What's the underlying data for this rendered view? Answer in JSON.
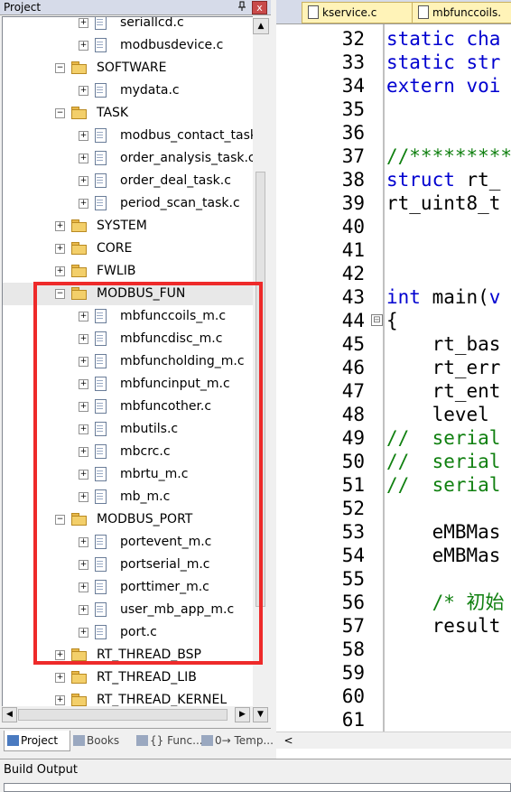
{
  "project_panel": {
    "title": "Project",
    "pin_icon": "pin-icon",
    "close_glyph": "x"
  },
  "tree": [
    {
      "type": "file",
      "indent": 2,
      "label": "seriallcd.c"
    },
    {
      "type": "file",
      "indent": 2,
      "label": "modbusdevice.c"
    },
    {
      "type": "folder",
      "indent": 1,
      "label": "SOFTWARE",
      "expanded": true
    },
    {
      "type": "file",
      "indent": 2,
      "label": "mydata.c"
    },
    {
      "type": "folder",
      "indent": 1,
      "label": "TASK",
      "expanded": true
    },
    {
      "type": "file",
      "indent": 2,
      "label": "modbus_contact_task"
    },
    {
      "type": "file",
      "indent": 2,
      "label": "order_analysis_task.c"
    },
    {
      "type": "file",
      "indent": 2,
      "label": "order_deal_task.c"
    },
    {
      "type": "file",
      "indent": 2,
      "label": "period_scan_task.c"
    },
    {
      "type": "folder",
      "indent": 1,
      "label": "SYSTEM",
      "expanded": false
    },
    {
      "type": "folder",
      "indent": 1,
      "label": "CORE",
      "expanded": false
    },
    {
      "type": "folder",
      "indent": 1,
      "label": "FWLIB",
      "expanded": false
    },
    {
      "type": "folder",
      "indent": 1,
      "label": "MODBUS_FUN",
      "expanded": true,
      "selected": true
    },
    {
      "type": "file",
      "indent": 2,
      "label": "mbfunccoils_m.c"
    },
    {
      "type": "file",
      "indent": 2,
      "label": "mbfuncdisc_m.c"
    },
    {
      "type": "file",
      "indent": 2,
      "label": "mbfuncholding_m.c"
    },
    {
      "type": "file",
      "indent": 2,
      "label": "mbfuncinput_m.c"
    },
    {
      "type": "file",
      "indent": 2,
      "label": "mbfuncother.c"
    },
    {
      "type": "file",
      "indent": 2,
      "label": "mbutils.c"
    },
    {
      "type": "file",
      "indent": 2,
      "label": "mbcrc.c"
    },
    {
      "type": "file",
      "indent": 2,
      "label": "mbrtu_m.c"
    },
    {
      "type": "file",
      "indent": 2,
      "label": "mb_m.c"
    },
    {
      "type": "folder",
      "indent": 1,
      "label": "MODBUS_PORT",
      "expanded": true
    },
    {
      "type": "file",
      "indent": 2,
      "label": "portevent_m.c"
    },
    {
      "type": "file",
      "indent": 2,
      "label": "portserial_m.c"
    },
    {
      "type": "file",
      "indent": 2,
      "label": "porttimer_m.c"
    },
    {
      "type": "file",
      "indent": 2,
      "label": "user_mb_app_m.c"
    },
    {
      "type": "file",
      "indent": 2,
      "label": "port.c"
    },
    {
      "type": "folder",
      "indent": 1,
      "label": "RT_THREAD_BSP",
      "expanded": false
    },
    {
      "type": "folder",
      "indent": 1,
      "label": "RT_THREAD_LIB",
      "expanded": false
    },
    {
      "type": "folder",
      "indent": 1,
      "label": "RT_THREAD_KERNEL",
      "expanded": false
    }
  ],
  "bottom_tabs": [
    {
      "label": "Project",
      "icon": "project-icon",
      "active": true
    },
    {
      "label": "Books",
      "icon": "books-icon",
      "active": false
    },
    {
      "label": "{} Func...",
      "icon": "functions-icon",
      "active": false
    },
    {
      "label": "0→ Temp...",
      "icon": "templates-icon",
      "active": false
    }
  ],
  "editor": {
    "tabs": [
      {
        "label": "kservice.c"
      },
      {
        "label": "mbfunccoils."
      }
    ],
    "lines": [
      {
        "n": "32",
        "segs": [
          {
            "t": "static cha",
            "c": "kw"
          }
        ]
      },
      {
        "n": "33",
        "segs": [
          {
            "t": "static str",
            "c": "kw"
          }
        ]
      },
      {
        "n": "34",
        "segs": [
          {
            "t": "extern voi",
            "c": "kw"
          }
        ]
      },
      {
        "n": "35",
        "segs": []
      },
      {
        "n": "36",
        "segs": []
      },
      {
        "n": "37",
        "segs": [
          {
            "t": "//*********",
            "c": "cm"
          }
        ]
      },
      {
        "n": "38",
        "segs": [
          {
            "t": "struct",
            "c": "kw"
          },
          {
            "t": " rt_",
            "c": ""
          }
        ]
      },
      {
        "n": "39",
        "segs": [
          {
            "t": "rt_uint8_t",
            "c": ""
          }
        ]
      },
      {
        "n": "40",
        "segs": []
      },
      {
        "n": "41",
        "segs": []
      },
      {
        "n": "42",
        "segs": []
      },
      {
        "n": "43",
        "segs": [
          {
            "t": "int",
            "c": "kw"
          },
          {
            "t": " main(",
            "c": ""
          },
          {
            "t": "v",
            "c": "kw"
          }
        ]
      },
      {
        "n": "44",
        "segs": [
          {
            "t": "{",
            "c": ""
          }
        ]
      },
      {
        "n": "45",
        "segs": [
          {
            "t": "    rt_bas",
            "c": ""
          }
        ]
      },
      {
        "n": "46",
        "segs": [
          {
            "t": "    rt_err",
            "c": ""
          }
        ]
      },
      {
        "n": "47",
        "segs": [
          {
            "t": "    rt_ent",
            "c": ""
          }
        ]
      },
      {
        "n": "48",
        "segs": [
          {
            "t": "    level ",
            "c": ""
          }
        ]
      },
      {
        "n": "49",
        "segs": [
          {
            "t": "//  serial",
            "c": "cm"
          }
        ]
      },
      {
        "n": "50",
        "segs": [
          {
            "t": "//  serial",
            "c": "cm"
          }
        ]
      },
      {
        "n": "51",
        "segs": [
          {
            "t": "//  serial",
            "c": "cm"
          }
        ]
      },
      {
        "n": "52",
        "segs": []
      },
      {
        "n": "53",
        "segs": [
          {
            "t": "    eMBMas",
            "c": ""
          }
        ]
      },
      {
        "n": "54",
        "segs": [
          {
            "t": "    eMBMas",
            "c": ""
          }
        ]
      },
      {
        "n": "55",
        "segs": []
      },
      {
        "n": "56",
        "segs": [
          {
            "t": "    /* 初始",
            "c": "cm"
          }
        ]
      },
      {
        "n": "57",
        "segs": [
          {
            "t": "    result",
            "c": ""
          }
        ]
      },
      {
        "n": "58",
        "segs": []
      },
      {
        "n": "59",
        "segs": []
      },
      {
        "n": "60",
        "segs": []
      },
      {
        "n": "61",
        "segs": []
      }
    ],
    "fold_glyph": "⊟",
    "scroll_left_glyph": "<"
  },
  "build_output": {
    "title": "Build Output"
  },
  "colors": {
    "highlight_box": "#ee2a2a",
    "keyword": "#0000d0",
    "comment": "#108010"
  }
}
